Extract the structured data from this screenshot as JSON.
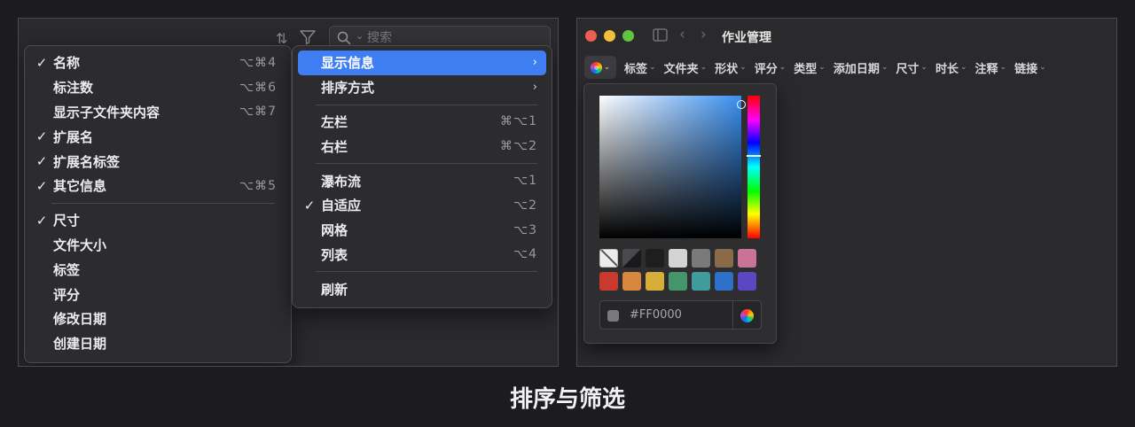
{
  "left_panel": {
    "search": {
      "placeholder": "搜索"
    },
    "menu_a": {
      "items": [
        {
          "label": "名称",
          "checked": true,
          "shortcut": "⌥⌘4"
        },
        {
          "label": "标注数",
          "checked": false,
          "shortcut": "⌥⌘6"
        },
        {
          "label": "显示子文件夹内容",
          "checked": false,
          "shortcut": "⌥⌘7"
        },
        {
          "label": "扩展名",
          "checked": true,
          "shortcut": ""
        },
        {
          "label": "扩展名标签",
          "checked": true,
          "shortcut": ""
        },
        {
          "label": "其它信息",
          "checked": true,
          "shortcut": "⌥⌘5"
        },
        {
          "label": "尺寸",
          "checked": true,
          "shortcut": ""
        },
        {
          "label": "文件大小",
          "checked": false,
          "shortcut": ""
        },
        {
          "label": "标签",
          "checked": false,
          "shortcut": ""
        },
        {
          "label": "评分",
          "checked": false,
          "shortcut": ""
        },
        {
          "label": "修改日期",
          "checked": false,
          "shortcut": ""
        },
        {
          "label": "创建日期",
          "checked": false,
          "shortcut": ""
        }
      ],
      "check_glyph": "✓"
    },
    "menu_b": {
      "items": [
        {
          "label": "显示信息",
          "shortcut": "",
          "submenu": true,
          "active": true
        },
        {
          "label": "排序方式",
          "shortcut": "",
          "submenu": true
        },
        {
          "label": "左栏",
          "shortcut": "⌘⌥1"
        },
        {
          "label": "右栏",
          "shortcut": "⌘⌥2"
        },
        {
          "label": "瀑布流",
          "shortcut": "⌥1"
        },
        {
          "label": "自适应",
          "shortcut": "⌥2",
          "checked": true
        },
        {
          "label": "网格",
          "shortcut": "⌥3"
        },
        {
          "label": "列表",
          "shortcut": "⌥4"
        },
        {
          "label": "刷新",
          "shortcut": ""
        }
      ],
      "arrow_glyph": "›"
    }
  },
  "right_panel": {
    "window_title": "作业管理",
    "filters": [
      "标签",
      "文件夹",
      "形状",
      "评分",
      "类型",
      "添加日期",
      "尺寸",
      "时长",
      "注释",
      "链接"
    ],
    "chevron": "⌄",
    "color_picker": {
      "hex_value": "#FF0000",
      "swatch_rows": [
        [
          "none",
          "half",
          "#1e1e1e",
          "#d4d4d4",
          "#7a7a7a",
          "#8a6a48",
          "#c97398"
        ],
        [
          "#c9392e",
          "#d8853e",
          "#d8ae3a",
          "#44966a",
          "#409c9c",
          "#2e6fc9",
          "#5a48c2"
        ]
      ]
    }
  },
  "caption": "排序与筛选"
}
